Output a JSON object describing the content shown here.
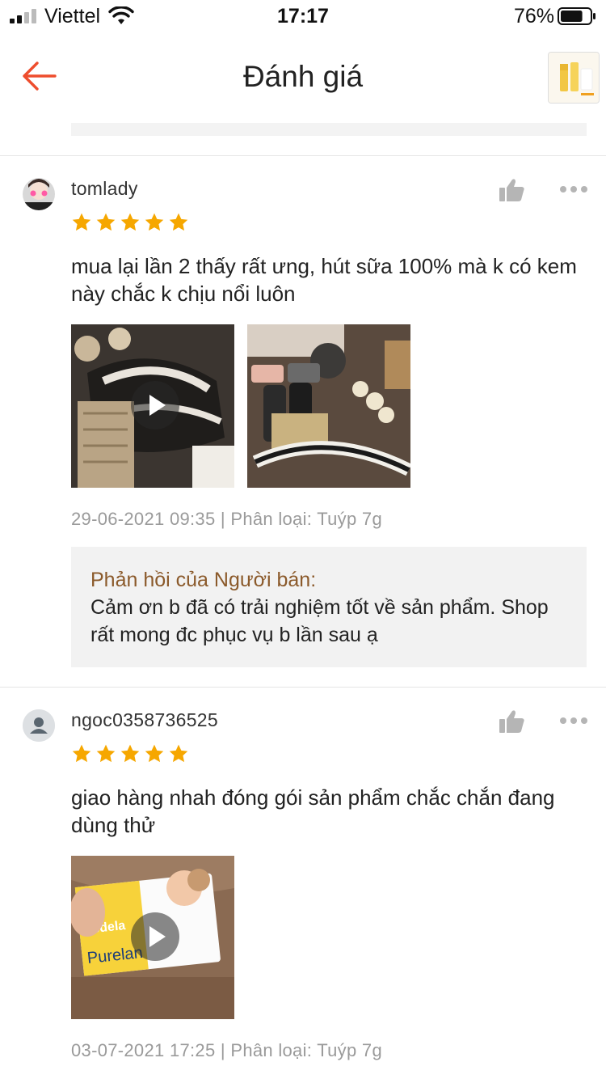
{
  "status_bar": {
    "carrier": "Viettel",
    "time": "17:17",
    "battery_percent": "76%",
    "battery_level": 0.76,
    "icons": [
      "signal-icon",
      "wifi-icon",
      "battery-icon"
    ]
  },
  "nav": {
    "title": "Đánh giá",
    "back_icon": "arrow-left-icon",
    "accent_color": "#ee4d2d"
  },
  "reviews": [
    {
      "username": "tomlady",
      "rating": 5,
      "text": "mua lại lần 2 thấy rất ưng, hút sữa 100% mà k có kem này chắc k chịu nổi luôn",
      "media": [
        {
          "kind": "video",
          "icon": "play-icon"
        },
        {
          "kind": "image"
        }
      ],
      "meta": "29-06-2021 09:35 | Phân loại: Tuýp 7g",
      "seller_reply": {
        "label": "Phản hồi của Người bán:",
        "text": "Cảm ơn b đã có trải nghiệm tốt về sản phẩm. Shop rất mong đc phục vụ b lần sau ạ"
      }
    },
    {
      "username": "ngoc0358736525",
      "rating": 5,
      "text": "giao hàng nhah đóng gói sản phẩm chắc chắn đang dùng thử",
      "media": [
        {
          "kind": "video",
          "icon": "play-icon",
          "brand": "medela",
          "product": "Purelan"
        }
      ],
      "meta": "03-07-2021 17:25 | Phân loại: Tuýp 7g"
    }
  ],
  "colors": {
    "star": "#f6a700",
    "seller_label": "#8b5a2b",
    "meta": "#9a9a9a"
  }
}
